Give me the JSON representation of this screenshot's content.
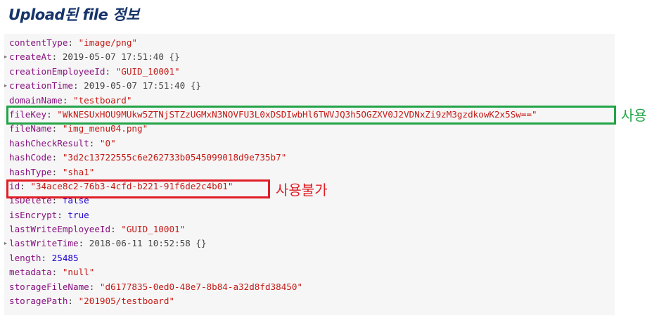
{
  "title": "Upload된 file 정보",
  "properties": [
    {
      "key": "contentType",
      "value": "\"image/png\"",
      "type": "string",
      "expandable": false
    },
    {
      "key": "createAt",
      "value": "2019-05-07 17:51:40 {}",
      "type": "object",
      "expandable": true
    },
    {
      "key": "creationEmployeeId",
      "value": "\"GUID_10001\"",
      "type": "string",
      "expandable": false
    },
    {
      "key": "creationTime",
      "value": "2019-05-07 17:51:40 {}",
      "type": "object",
      "expandable": true
    },
    {
      "key": "domainName",
      "value": "\"testboard\"",
      "type": "string",
      "expandable": false
    },
    {
      "key": "fileKey",
      "value": "\"WkNESUxHOU9MUkw5ZTNjSTZzUGMxN3NOVFU3L0xDSDIwbHl6TWVJQ3h5OGZXV0J2VDNxZi9zM3gzdkowK2x5Sw==\"",
      "type": "string",
      "expandable": false
    },
    {
      "key": "fileName",
      "value": "\"img_menu04.png\"",
      "type": "string",
      "expandable": false
    },
    {
      "key": "hashCheckResult",
      "value": "\"0\"",
      "type": "string",
      "expandable": false
    },
    {
      "key": "hashCode",
      "value": "\"3d2c13722555c6e262733b0545099018d9e735b7\"",
      "type": "string",
      "expandable": false
    },
    {
      "key": "hashType",
      "value": "\"sha1\"",
      "type": "string",
      "expandable": false
    },
    {
      "key": "id",
      "value": "\"34ace8c2-76b3-4cfd-b221-91f6de2c4b01\"",
      "type": "string",
      "expandable": false
    },
    {
      "key": "isDelete",
      "value": "false",
      "type": "keyword",
      "expandable": false
    },
    {
      "key": "isEncrypt",
      "value": "true",
      "type": "keyword",
      "expandable": false
    },
    {
      "key": "lastWriteEmployeeId",
      "value": "\"GUID_10001\"",
      "type": "string",
      "expandable": false
    },
    {
      "key": "lastWriteTime",
      "value": "2018-06-11 10:52:58 {}",
      "type": "object",
      "expandable": true
    },
    {
      "key": "length",
      "value": "25485",
      "type": "number",
      "expandable": false
    },
    {
      "key": "metadata",
      "value": "\"null\"",
      "type": "string",
      "expandable": false
    },
    {
      "key": "storageFileName",
      "value": "\"d6177835-0ed0-48e7-8b84-a32d8fd38450\"",
      "type": "string",
      "expandable": false
    },
    {
      "key": "storagePath",
      "value": "\"201905/testboard\"",
      "type": "string",
      "expandable": false
    }
  ],
  "annotations": {
    "usable": {
      "label": "사용",
      "color": "#22a447",
      "target": "fileKey"
    },
    "unusable": {
      "label": "사용불가",
      "color": "#e01e27",
      "target": "id"
    }
  },
  "colors": {
    "key": "#881280",
    "string": "#c41a16",
    "keyword": "#1c00cf",
    "object": "#444444",
    "title": "#16346a"
  }
}
